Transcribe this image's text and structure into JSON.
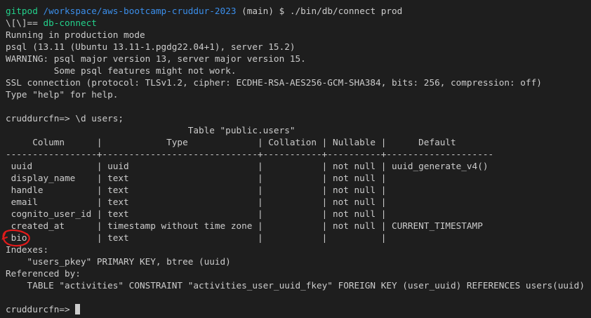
{
  "prompt1": {
    "user": "gitpod",
    "path": "/workspace/aws-bootcamp-cruddur-2023",
    "branch": " (main)",
    "symbol": " $ ",
    "command": "./bin/db/connect prod"
  },
  "echo_prefix": "\\[\\]== ",
  "echo_text": "db-connect",
  "intro_lines": [
    "Running in production mode",
    "psql (13.11 (Ubuntu 13.11-1.pgdg22.04+1), server 15.2)",
    "WARNING: psql major version 13, server major version 15.",
    "         Some psql features might not work.",
    "SSL connection (protocol: TLSv1.2, cipher: ECDHE-RSA-AES256-GCM-SHA384, bits: 256, compression: off)",
    "Type \"help\" for help.",
    ""
  ],
  "describe_cmd": "cruddurcfn=> \\d users;",
  "table_lines": [
    "                                  Table \"public.users\"",
    "     Column      |            Type             | Collation | Nullable |      Default",
    "-----------------+-----------------------------+-----------+----------+--------------------",
    " uuid            | uuid                        |           | not null | uuid_generate_v4()",
    " display_name    | text                        |           | not null |",
    " handle          | text                        |           | not null |",
    " email           | text                        |           | not null |",
    " cognito_user_id | text                        |           | not null |",
    " created_at      | timestamp without time zone |           | not null | CURRENT_TIMESTAMP",
    " bio             | text                        |           |          |",
    "Indexes:",
    "    \"users_pkey\" PRIMARY KEY, btree (uuid)",
    "Referenced by:",
    "    TABLE \"activities\" CONSTRAINT \"activities_user_uuid_fkey\" FOREIGN KEY (user_uuid) REFERENCES users(uuid)",
    ""
  ],
  "final_prompt": "cruddurcfn=> ",
  "colors": {
    "background": "#1e1e1e",
    "text": "#cccccc",
    "green": "#23d18b",
    "blue": "#3b8eea",
    "annotation_red": "#e01b1b"
  }
}
